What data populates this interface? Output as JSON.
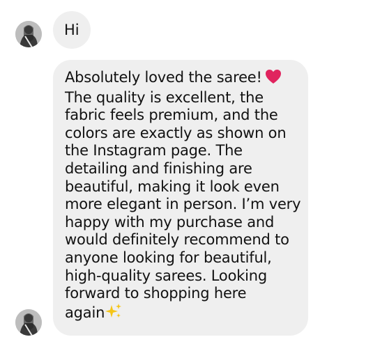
{
  "conversation": {
    "messages": [
      {
        "text": "Hi",
        "avatar": "user-avatar"
      },
      {
        "lines": [
          "Absolutely loved the saree!",
          "The quality is excellent, the",
          "fabric feels premium, and the",
          "colors are exactly as shown on",
          "the Instagram page. The",
          "detailing and finishing are",
          "beautiful, making it look even",
          "more elegant in person. I’m very",
          "happy with my purchase and",
          "would definitely recommend to",
          "anyone looking for beautiful,",
          "high-quality sarees. Looking",
          "forward to shopping here",
          "again"
        ],
        "emojis": {
          "heart": "red-heart-emoji",
          "sparkles": "sparkles-emoji"
        },
        "avatar": "user-avatar"
      }
    ]
  },
  "colors": {
    "bubble_background": "#efefef",
    "text": "#111111",
    "heart": "#e0245e",
    "sparkles": "#f5c518"
  }
}
